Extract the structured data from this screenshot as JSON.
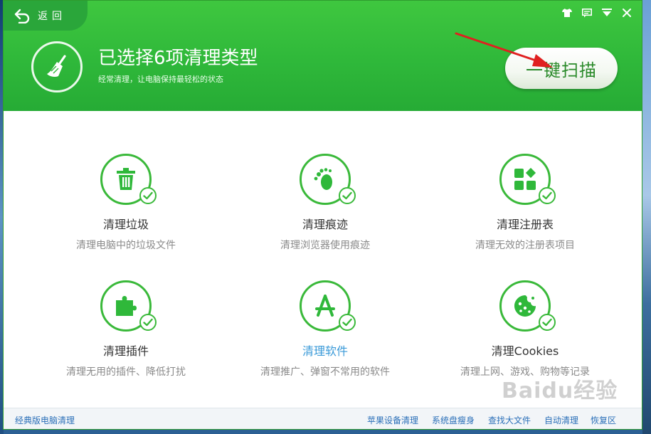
{
  "header": {
    "back_label": "返回",
    "title": "已选择6项清理类型",
    "subtitle": "经常清理，让电脑保持最轻松的状态",
    "scan_button": "一键扫描"
  },
  "window_controls": [
    "skin-icon",
    "feedback-icon",
    "menu-icon",
    "close-icon"
  ],
  "items": [
    {
      "title": "清理垃圾",
      "desc": "清理电脑中的垃圾文件",
      "icon": "trash-icon"
    },
    {
      "title": "清理痕迹",
      "desc": "清理浏览器使用痕迹",
      "icon": "footprint-icon"
    },
    {
      "title": "清理注册表",
      "desc": "清理无效的注册表项目",
      "icon": "registry-icon"
    },
    {
      "title": "清理插件",
      "desc": "清理无用的插件、降低打扰",
      "icon": "puzzle-icon"
    },
    {
      "title": "清理软件",
      "desc": "清理推广、弹窗不常用的软件",
      "icon": "app-icon"
    },
    {
      "title": "清理Cookies",
      "desc": "清理上网、游戏、购物等记录",
      "icon": "cookie-icon"
    }
  ],
  "footer": {
    "classic": "经典版电脑清理",
    "apple": "苹果设备清理",
    "slim": "系统盘瘦身",
    "bigfile": "查找大文件",
    "auto": "自动清理",
    "restore": "恢复区"
  },
  "watermark": "Baidu经验",
  "colors": {
    "brand_green": "#2fb83a",
    "link_blue": "#2a6fb8",
    "active_title": "#3a9ad8"
  }
}
